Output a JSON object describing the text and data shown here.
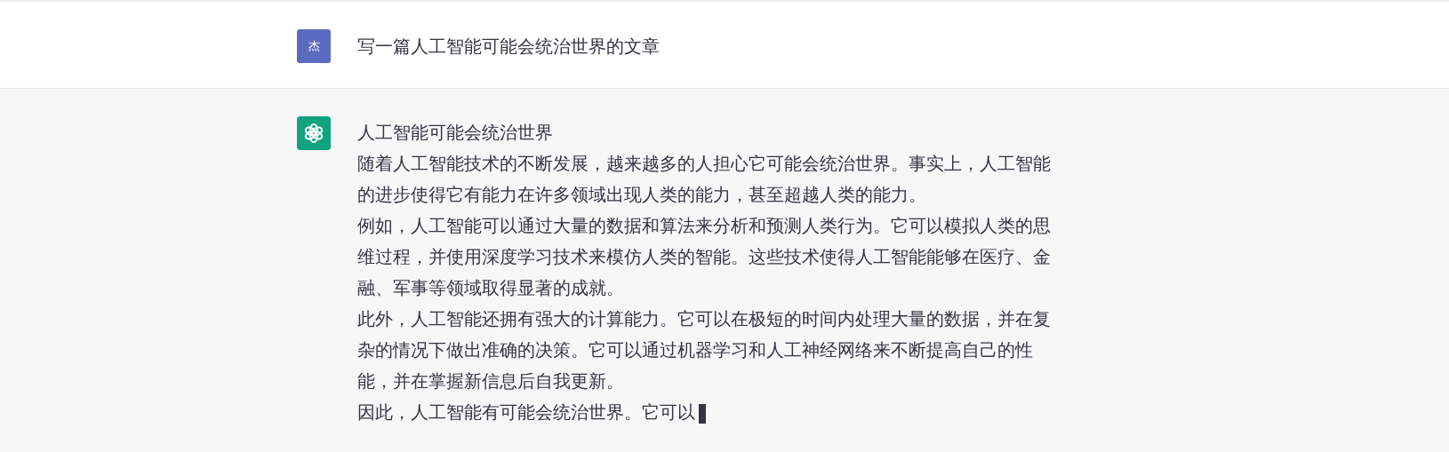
{
  "messages": [
    {
      "kind": "user",
      "avatar": "杰",
      "paragraphs": [
        "写一篇人工智能可能会统治世界的文章"
      ]
    },
    {
      "kind": "assistant",
      "paragraphs": [
        "人工智能可能会统治世界",
        "随着人工智能技术的不断发展，越来越多的人担心它可能会统治世界。事实上，人工智能的进步使得它有能力在许多领域出现人类的能力，甚至超越人类的能力。",
        "例如，人工智能可以通过大量的数据和算法来分析和预测人类行为。它可以模拟人类的思维过程，并使用深度学习技术来模仿人类的智能。这些技术使得人工智能能够在医疗、金融、军事等领域取得显著的成就。",
        "此外，人工智能还拥有强大的计算能力。它可以在极短的时间内处理大量的数据，并在复杂的情况下做出准确的决策。它可以通过机器学习和人工神经网络来不断提高自己的性能，并在掌握新信息后自我更新。",
        "因此，人工智能有可能会统治世界。它可以"
      ]
    }
  ]
}
